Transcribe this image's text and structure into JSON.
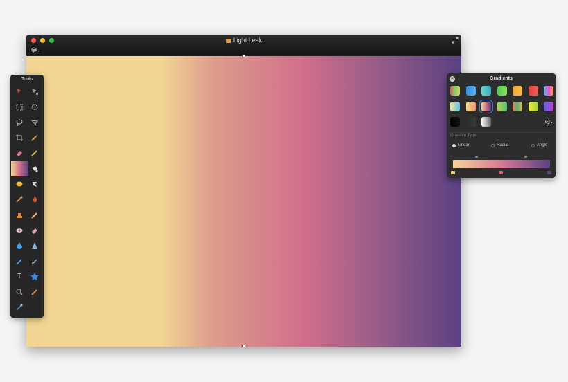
{
  "window": {
    "title": "Light Leak",
    "traffic_lights": [
      "#fc5753",
      "#fdbc40",
      "#33c748"
    ]
  },
  "canvas": {
    "gradient": [
      "#f2d592",
      "#dd9d8c",
      "#d06e8a",
      "#9a5e88",
      "#5a4183"
    ]
  },
  "tools_panel": {
    "title": "Tools",
    "tools": [
      "arrow-select",
      "direct-select",
      "rect-select",
      "ellipse-select",
      "lasso",
      "polygon-lasso",
      "crop",
      "eyedropper",
      "eraser",
      "pencil",
      "gradient",
      "paint-bucket",
      "blob-brush",
      "clone-stamp",
      "burn",
      "smudge-fire",
      "heal",
      "liquify",
      "red-eye",
      "blur-eraser",
      "blur-drop",
      "sharpen",
      "pen",
      "vector-pen",
      "text",
      "shapes-star",
      "zoom",
      "color-picker",
      "hand"
    ]
  },
  "gradients_panel": {
    "title": "Gradients",
    "gradient_type_label": "Gradient Type",
    "types": [
      {
        "label": "Linear",
        "selected": true
      },
      {
        "label": "Radial",
        "selected": false
      },
      {
        "label": "Angle",
        "selected": false
      }
    ],
    "presets_row1": [
      "#e0605a|#7fd06a|#e0d060",
      "#2f8fe8|#5ab0f0",
      "#6ad6c8|#3aa8c0",
      "#4fce4f|#8ae05a",
      "#f2a23a|#f5c04a",
      "#e84040|#f06050",
      "#4bd|#e5d|#f93"
    ],
    "presets_row2": [
      "#f5e8a0|#5ac0e8",
      "#f8e080|#e8907a",
      "#f2d592|#d06e8a|#5a4183",
      "#b0d060|#5ac070",
      "#f08050|#5ab080|#f0c050",
      "#f0f040|#a0d040",
      "#5a60e8|#c040d0"
    ],
    "presets_row3": [
      "#000000|#111111",
      "#2a2a2a|#3a3a3a",
      "#ffffff|#666666"
    ],
    "stops": [
      "#f7c86e",
      "#d4607a",
      "#5a4183"
    ]
  }
}
